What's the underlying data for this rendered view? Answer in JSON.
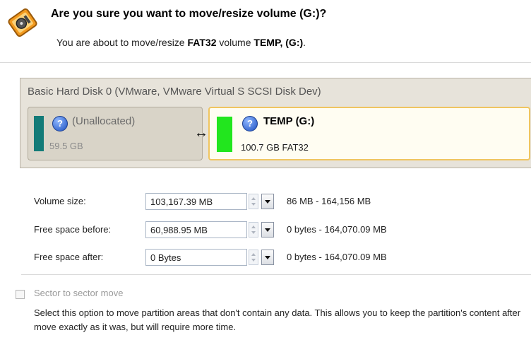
{
  "header": {
    "title": "Are you sure you want to move/resize volume (G:)?",
    "subtitle_prefix": "You are about to move/resize",
    "subtitle_fs": "FAT32",
    "subtitle_mid": "volume",
    "subtitle_volume": "TEMP, (G:)",
    "subtitle_end": ".",
    "icon": "disk-wizard-icon"
  },
  "disk": {
    "title": "Basic Hard Disk 0 (VMware, VMware Virtual S SCSI Disk Dev)",
    "partitions": [
      {
        "name": "(Unallocated)",
        "info": "59.5 GB",
        "color": "#137b78",
        "icon": "help-icon"
      },
      {
        "name": "TEMP (G:)",
        "info": "100.7 GB FAT32",
        "color": "#22e61e",
        "icon": "help-icon"
      }
    ],
    "resize_handle": "↔"
  },
  "fields": [
    {
      "label": "Volume size:",
      "value": "103,167.39 MB",
      "range": "86 MB - 164,156 MB"
    },
    {
      "label": "Free space before:",
      "value": "60,988.95 MB",
      "range": "0 bytes - 164,070.09 MB"
    },
    {
      "label": "Free space after:",
      "value": "0 Bytes",
      "range": "0 bytes - 164,070.09 MB"
    }
  ],
  "sector_move": {
    "label": "Sector to sector move",
    "checked": false,
    "description": "Select this option to move partition areas that don't contain any data. This allows you to keep the partition's content after move exactly as it was, but will require more time."
  }
}
